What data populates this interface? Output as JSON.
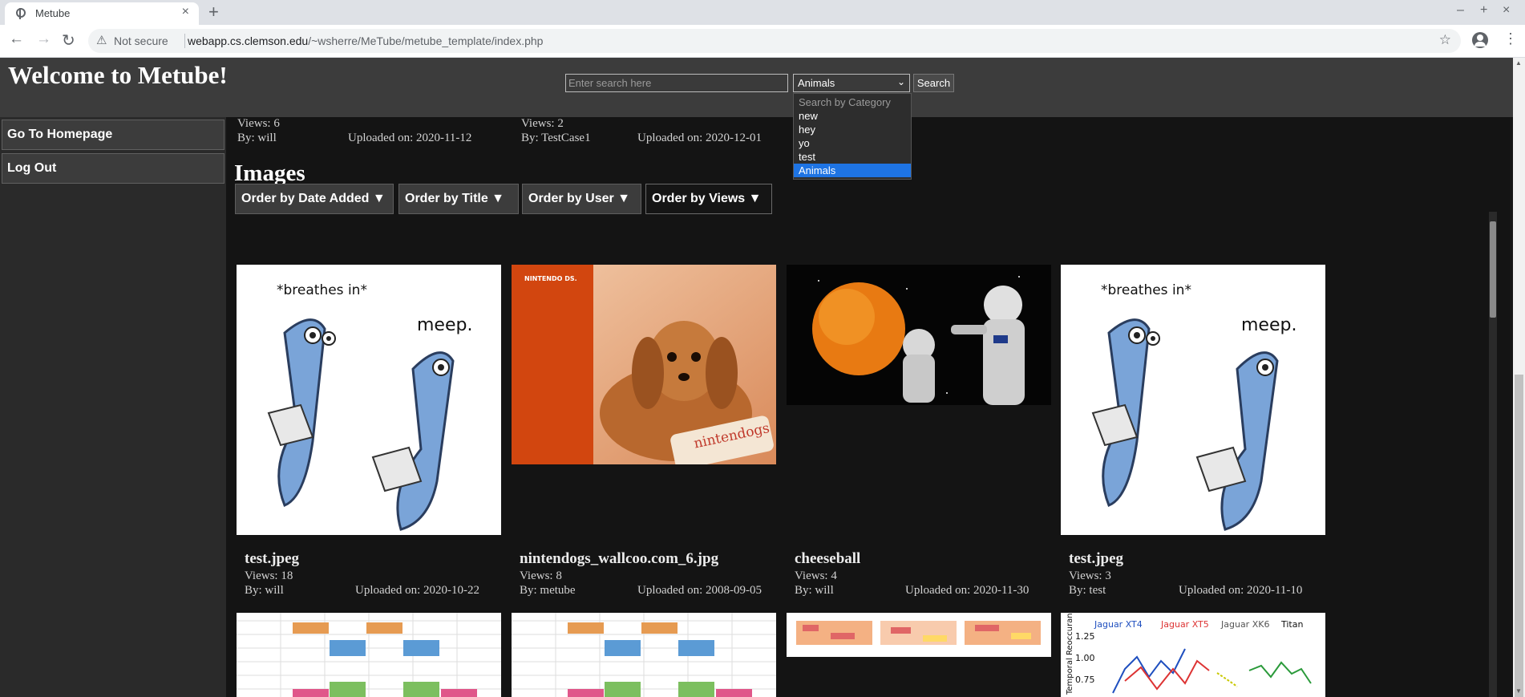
{
  "browser": {
    "tab_title": "Metube",
    "tab_close": "×",
    "new_tab": "+",
    "win_min": "–",
    "win_max": "+",
    "win_close": "×",
    "security_label": "Not secure",
    "url_host": "webapp.cs.clemson.edu",
    "url_path": "/~wsherre/MeTube/metube_template/index.php",
    "icons": [
      "favicon-icon",
      "back-icon",
      "forward-icon",
      "reload-icon",
      "warning-icon",
      "star-icon",
      "account-icon",
      "menu-icon"
    ]
  },
  "header": {
    "title": "Welcome to Metube!",
    "search_placeholder": "Enter search here",
    "category_selected": "Animals",
    "search_button": "Search",
    "category_options": [
      "Search by Category",
      "new",
      "hey",
      "yo",
      "test",
      "Animals"
    ]
  },
  "sidebar": {
    "items": [
      {
        "label": "Go To Homepage"
      },
      {
        "label": "Log Out"
      }
    ]
  },
  "previous_row": [
    {
      "views": "Views: 6",
      "by": "By: will",
      "uploaded": "Uploaded on: 2020-11-12"
    },
    {
      "views": "Views: 2",
      "by": "By: TestCase1",
      "uploaded": "Uploaded on: 2020-12-01"
    }
  ],
  "images_section": {
    "heading": "Images",
    "sort_buttons": [
      {
        "label": "Order by Date Added ▼"
      },
      {
        "label": "Order by Title ▼"
      },
      {
        "label": "Order by User ▼"
      },
      {
        "label": "Order by Views ▼",
        "active": true
      }
    ],
    "cards": [
      {
        "title": "test.jpeg",
        "views": "Views: 18",
        "by": "By: will",
        "uploaded": "Uploaded on: 2020-10-22",
        "thumb_text_1": "*breathes in*",
        "thumb_text_2": "meep."
      },
      {
        "title": "nintendogs_wallcoo.com_6.jpg",
        "views": "Views: 8",
        "by": "By: metube",
        "uploaded": "Uploaded on: 2008-09-05",
        "thumb_text_1": "NINTENDO DS.",
        "thumb_text_2": "nintendogs"
      },
      {
        "title": "cheeseball",
        "views": "Views: 4",
        "by": "By: will",
        "uploaded": "Uploaded on: 2020-11-30"
      },
      {
        "title": "test.jpeg",
        "views": "Views: 3",
        "by": "By: test",
        "uploaded": "Uploaded on: 2020-11-10",
        "thumb_text_1": "*breathes in*",
        "thumb_text_2": "meep."
      }
    ],
    "next_row_chart": {
      "legend": [
        "Jaguar XT4",
        "Jaguar XT5",
        "Jaguar XK6",
        "Titan"
      ],
      "ticks": [
        "1.25",
        "1.00",
        "0.75"
      ],
      "ylabel": "Temporal Reoccurance Parameter"
    }
  },
  "colors": {
    "page_bg": "#141414",
    "header_bg": "#3c3c3c",
    "sidebar_bg": "#2a2a2a",
    "selected_option": "#1e74e4"
  }
}
